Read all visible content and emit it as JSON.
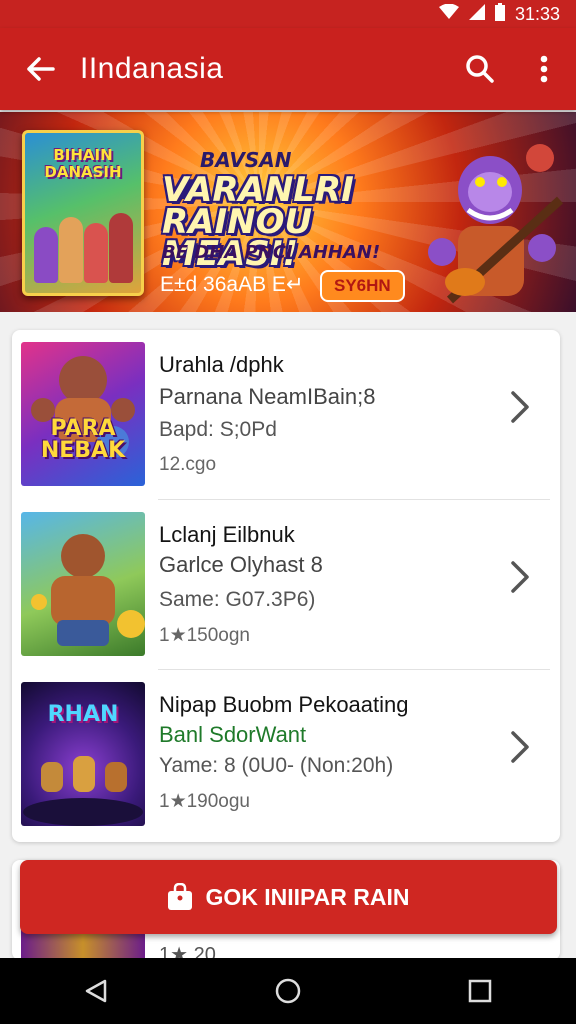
{
  "status_bar": {
    "time": "31:33"
  },
  "app_bar": {
    "title": "IIndanasia"
  },
  "banner": {
    "cover_title": "BIHAIN DANASIH",
    "kicker": "BAVSAN",
    "headline": "VARANLRI RAINOU MEASI!",
    "subline": "BE DHA PNCI AHHAN!",
    "meta": "E±d 36aAB E↵",
    "button": "SY6HN"
  },
  "list": {
    "items": [
      {
        "title": "Urahla /dphk",
        "subtitle": "Parnana NeamIBain;8",
        "meta": "Bapd: S;0Pd",
        "count": "12.cgo",
        "thumb_label": "PARA NEBAK"
      },
      {
        "title": "Lclanj Eilbnuk",
        "subtitle": "Garlce Olyhast 8",
        "meta": "Same: G07.3P6)",
        "count": "1★150ogn",
        "thumb_label": ""
      },
      {
        "title": "Nipap Buobm Pekoaating",
        "subtitle": "Banl SdorWant",
        "subtitle_color": "#1f7a2a",
        "meta": "Yame: 8 (0U0- (Non:20h)",
        "count": "1★190ogu",
        "thumb_label": "RHAN"
      }
    ]
  },
  "peek_item": {
    "count": "1★ 20..."
  },
  "cta": {
    "label": "GOK INIIPAR RAIN"
  },
  "colors": {
    "primary": "#c9211e",
    "cta": "#cf2722"
  }
}
